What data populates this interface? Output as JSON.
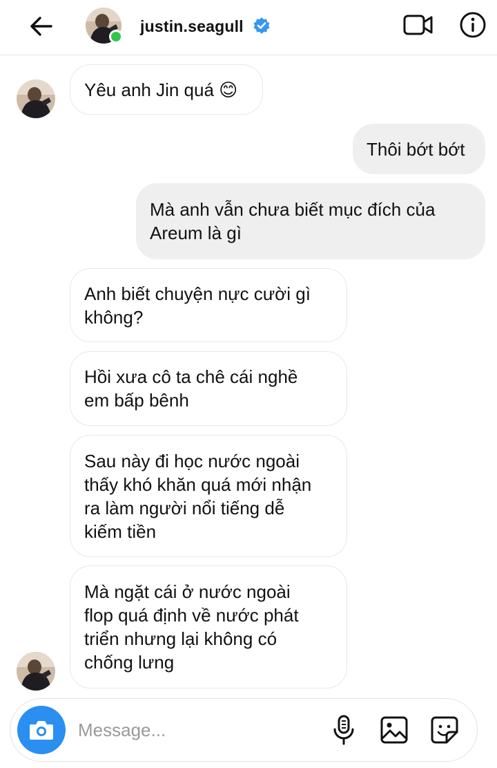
{
  "header": {
    "username": "justin.seagull",
    "icons": {
      "back": "arrow-left-icon",
      "verified": "verified-badge-icon",
      "video": "video-call-icon",
      "info": "info-icon"
    },
    "online_status_color": "#2fc84c",
    "verified_color": "#3897f0"
  },
  "messages": [
    {
      "direction": "incoming",
      "text": "Yêu anh Jin quá 😊"
    },
    {
      "direction": "outgoing",
      "text": "Thôi bớt bớt"
    },
    {
      "direction": "outgoing",
      "text": "Mà anh vẫn chưa biết mục đích của\nAreum là gì"
    },
    {
      "direction": "incoming",
      "text": "Anh biết chuyện nực cười gì\nkhông?"
    },
    {
      "direction": "incoming",
      "text": "Hồi xưa cô ta chê cái nghề\nem bấp bênh"
    },
    {
      "direction": "incoming",
      "text": "Sau này đi học nước ngoài\nthấy khó khăn quá mới nhận\nra làm người nổi tiếng dễ\nkiếm tiền"
    },
    {
      "direction": "incoming",
      "text": "Mà ngặt cái ở nước ngoài\nflop quá định về nước phát\ntriển nhưng lại không có\nchống lưng"
    }
  ],
  "composer": {
    "placeholder": "Message...",
    "camera_color": "#2a8ff0",
    "icons": [
      "camera-icon",
      "microphone-icon",
      "gallery-icon",
      "sticker-icon"
    ]
  }
}
